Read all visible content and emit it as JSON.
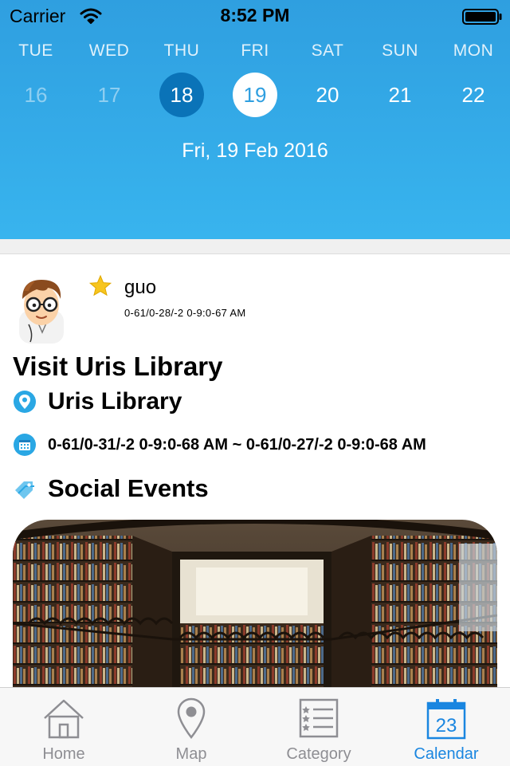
{
  "status_bar": {
    "carrier": "Carrier",
    "time": "8:52 PM"
  },
  "week": {
    "days": [
      {
        "weekday": "TUE",
        "date": "16",
        "state": "past"
      },
      {
        "weekday": "WED",
        "date": "17",
        "state": "past"
      },
      {
        "weekday": "THU",
        "date": "18",
        "state": "today"
      },
      {
        "weekday": "FRI",
        "date": "19",
        "state": "selected"
      },
      {
        "weekday": "SAT",
        "date": "20",
        "state": "normal"
      },
      {
        "weekday": "SUN",
        "date": "21",
        "state": "normal"
      },
      {
        "weekday": "MON",
        "date": "22",
        "state": "normal"
      }
    ],
    "selected_label": "Fri, 19 Feb 2016"
  },
  "event": {
    "user_name": "guo",
    "posted_time": "0-61/0-28/-2 0-9:0-67 AM",
    "title": "Visit Uris Library",
    "location": "Uris Library",
    "time_range": "0-61/0-31/-2 0-9:0-68 AM ~ 0-61/0-27/-2 0-9:0-68 AM",
    "category": "Social Events",
    "icons": {
      "favorite": "star-icon",
      "location": "location-pin-icon",
      "time": "calendar-icon",
      "category": "tag-icon"
    }
  },
  "tabs": [
    {
      "label": "Home",
      "icon": "home-icon",
      "active": false
    },
    {
      "label": "Map",
      "icon": "map-pin-icon",
      "active": false
    },
    {
      "label": "Category",
      "icon": "list-icon",
      "active": false
    },
    {
      "label": "Calendar",
      "icon": "calendar-icon",
      "active": true,
      "icon_text": "23"
    }
  ],
  "colors": {
    "header_top": "#2f9fe0",
    "header_bottom": "#38b4ee",
    "today_circle": "#0a73b8",
    "active_tab": "#1a86e0",
    "inactive_tab": "#8e8e93",
    "icon_blue": "#2aa7e4"
  }
}
